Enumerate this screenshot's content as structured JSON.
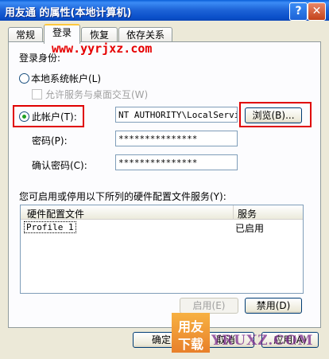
{
  "window": {
    "title": "用友通 的属性(本地计算机)",
    "help_label": "?",
    "close_label": "✕"
  },
  "tabs": [
    {
      "label": "常规",
      "active": false
    },
    {
      "label": "登录",
      "active": true
    },
    {
      "label": "恢复",
      "active": false
    },
    {
      "label": "依存关系",
      "active": false
    }
  ],
  "watermark": {
    "url": "www.yyrjxz.com",
    "logo_text": [
      "用友",
      "下载"
    ],
    "bottom_text": "YRUXZ.COM"
  },
  "logon": {
    "group_label": "登录身份:",
    "local_system_label": "本地系统帐户(L)",
    "allow_desktop_label": "允许服务与桌面交互(W)",
    "this_account_label": "此帐户(T):",
    "account_value": "NT AUTHORITY\\LocalService",
    "browse_label": "浏览(B)...",
    "password_label": "密码(P):",
    "password_value": "***************",
    "confirm_label": "确认密码(C):",
    "confirm_value": "***************",
    "selected": "this_account"
  },
  "hardware": {
    "description": "您可启用或停用以下所列的硬件配置文件服务(Y):",
    "columns": [
      "硬件配置文件",
      "服务"
    ],
    "rows": [
      {
        "profile": "Profile 1",
        "service": "已启用"
      }
    ],
    "enable_label": "启用(E)",
    "disable_label": "禁用(D)"
  },
  "footer": {
    "ok_label": "确定",
    "cancel_label": "取消",
    "apply_label": "应用(A)"
  },
  "colors": {
    "highlight_box": "#e00000",
    "title_bar": "#0a5fd8",
    "radio_dot": "#21a121"
  }
}
